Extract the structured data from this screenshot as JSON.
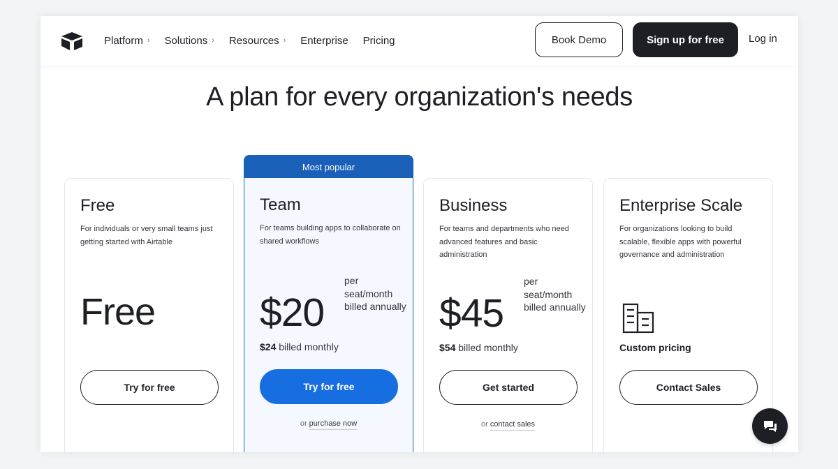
{
  "nav": {
    "links": [
      {
        "label": "Platform",
        "chevron": true
      },
      {
        "label": "Solutions",
        "chevron": true
      },
      {
        "label": "Resources",
        "chevron": true
      },
      {
        "label": "Enterprise",
        "chevron": false
      },
      {
        "label": "Pricing",
        "chevron": false
      }
    ],
    "chevron_glyph": "›",
    "book_demo": "Book Demo",
    "signup": "Sign up for free",
    "login": "Log in"
  },
  "headline": "A plan for every organization's needs",
  "popular_badge": "Most popular",
  "plans": [
    {
      "name": "Free",
      "description": "For individuals or very small teams just getting started with Airtable",
      "price": "Free",
      "cta": "Try for free"
    },
    {
      "name": "Team",
      "description": "For teams building apps to collaborate on shared workflows",
      "price": "$20",
      "price_note": "per seat/month billed annually",
      "monthly_amount": "$24",
      "monthly_text": " billed monthly",
      "cta": "Try for free",
      "sub_prefix": "or ",
      "sub_link": "purchase now"
    },
    {
      "name": "Business",
      "description": "For teams and departments who need advanced features and basic administration",
      "price": "$45",
      "price_note": "per seat/month billed annually",
      "monthly_amount": "$54",
      "monthly_text": " billed monthly",
      "cta": "Get started",
      "sub_prefix": "or ",
      "sub_link": "contact sales"
    },
    {
      "name": "Enterprise Scale",
      "description": "For organizations looking to build scalable, flexible apps with powerful governance and administration",
      "icon": "building-icon",
      "custom_pricing": "Custom pricing",
      "cta": "Contact Sales"
    }
  ],
  "colors": {
    "accent_blue": "#166ee1",
    "popular_blue": "#1a5fb8",
    "dark": "#1d1f25"
  }
}
